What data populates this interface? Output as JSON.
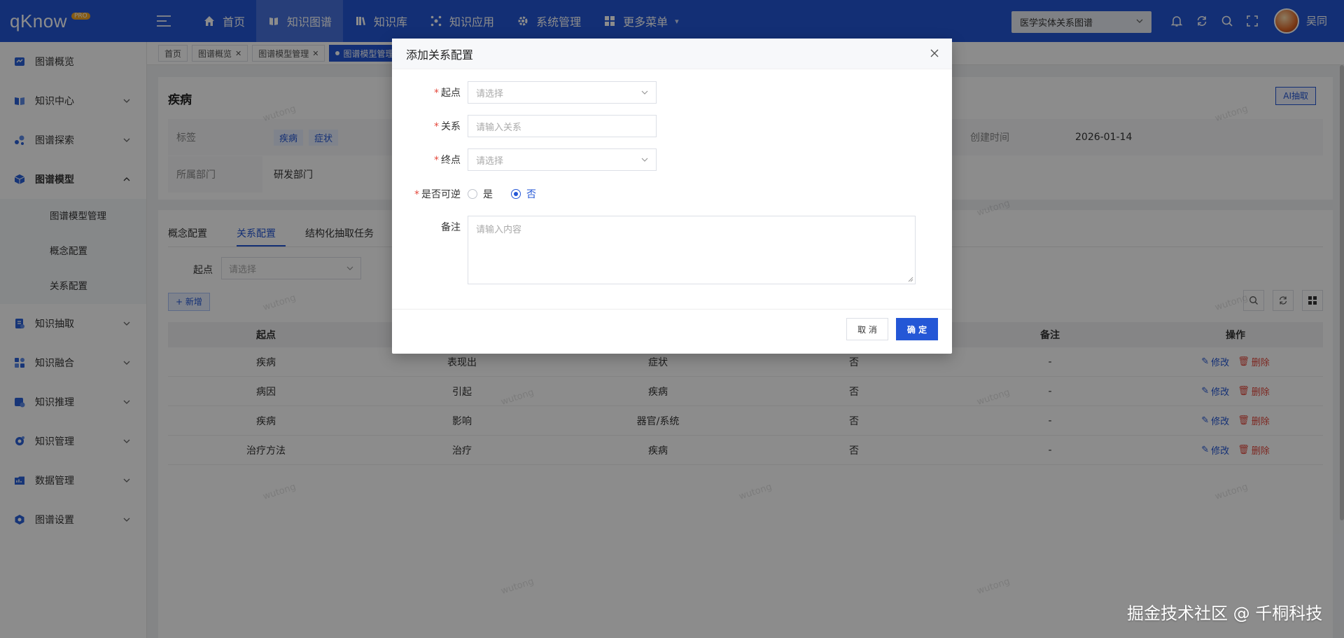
{
  "app": {
    "logo": "qKnow",
    "logo_badge": "PRO",
    "kg_selector": "医学实体关系图谱",
    "username": "吴同"
  },
  "topnav": [
    {
      "label": "首页",
      "icon": "home-icon"
    },
    {
      "label": "知识图谱",
      "icon": "book-icon",
      "active": true
    },
    {
      "label": "知识库",
      "icon": "library-icon"
    },
    {
      "label": "知识应用",
      "icon": "app-icon"
    },
    {
      "label": "系统管理",
      "icon": "gear-icon"
    },
    {
      "label": "更多菜单",
      "icon": "grid-icon",
      "dropdown": true
    }
  ],
  "sidebar": {
    "items": [
      {
        "label": "图谱概览",
        "icon": "overview-icon"
      },
      {
        "label": "知识中心",
        "icon": "book-icon"
      },
      {
        "label": "图谱探索",
        "icon": "explore-icon"
      },
      {
        "label": "图谱模型",
        "icon": "cube-icon"
      },
      {
        "label": "知识抽取",
        "icon": "extract-icon"
      },
      {
        "label": "知识融合",
        "icon": "fusion-icon"
      },
      {
        "label": "知识推理",
        "icon": "reason-icon"
      },
      {
        "label": "知识管理",
        "icon": "manage-icon"
      },
      {
        "label": "数据管理",
        "icon": "data-icon"
      },
      {
        "label": "图谱设置",
        "icon": "settings-icon"
      }
    ],
    "subitems": [
      "图谱模型管理",
      "概念配置",
      "关系配置"
    ]
  },
  "tags": [
    {
      "label": "首页"
    },
    {
      "label": "图谱概览",
      "closable": true
    },
    {
      "label": "图谱模型管理",
      "closable": true
    },
    {
      "label": "图谱模型管理",
      "active": true
    }
  ],
  "concept": {
    "title": "疾病",
    "ai_button": "AI抽取",
    "tag_label": "标签",
    "tags": [
      "疾病",
      "症状"
    ],
    "created_label": "创建时间",
    "created_value": "2026-01-14",
    "dept_label": "所属部门",
    "dept_value": "研发部门"
  },
  "subtabs": [
    "概念配置",
    "关系配置",
    "结构化抽取任务"
  ],
  "filter": {
    "label": "起点",
    "placeholder": "请选择"
  },
  "add_button": "+ 新增",
  "table": {
    "headers": [
      "起点",
      "",
      "",
      "",
      "备注",
      "操作"
    ],
    "rows": [
      [
        "疾病",
        "表现出",
        "症状",
        "否",
        "-"
      ],
      [
        "病因",
        "引起",
        "疾病",
        "否",
        "-"
      ],
      [
        "疾病",
        "影响",
        "器官/系统",
        "否",
        "-"
      ],
      [
        "治疗方法",
        "治疗",
        "疾病",
        "否",
        "-"
      ]
    ],
    "edit_label": "修改",
    "delete_label": "删除"
  },
  "watermark": "wutong",
  "modal": {
    "title": "添加关系配置",
    "fields": {
      "start": {
        "label": "起点",
        "placeholder": "请选择"
      },
      "relation": {
        "label": "关系",
        "placeholder": "请输入关系"
      },
      "end": {
        "label": "终点",
        "placeholder": "请选择"
      },
      "reversible": {
        "label": "是否可逆",
        "options": [
          "是",
          "否"
        ],
        "selected": "否"
      },
      "remark": {
        "label": "备注",
        "placeholder": "请输入内容"
      }
    },
    "cancel": "取 消",
    "confirm": "确 定"
  },
  "credit": "掘金技术社区 @ 千桐科技",
  "colors": {
    "primary": "#2457d6",
    "danger": "#e4483c"
  }
}
